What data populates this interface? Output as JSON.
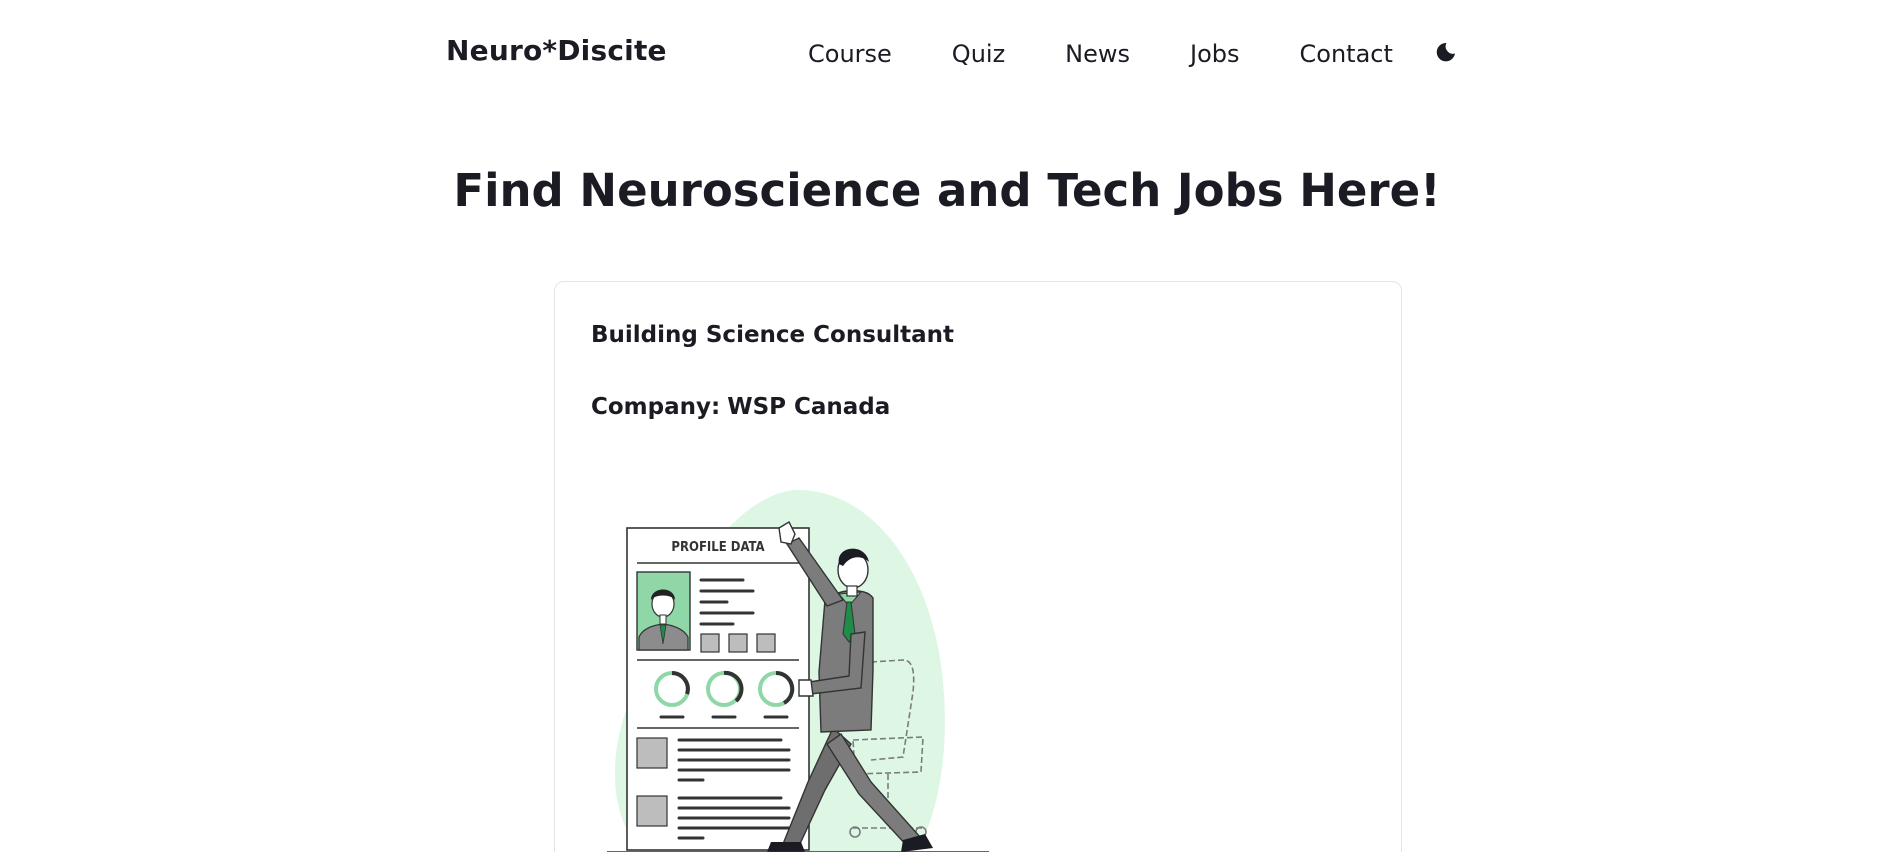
{
  "navbar": {
    "brand": "Neuro*Discite",
    "links": [
      {
        "label": "Course"
      },
      {
        "label": "Quiz"
      },
      {
        "label": "News"
      },
      {
        "label": "Jobs"
      },
      {
        "label": "Contact"
      }
    ],
    "theme_icon": "moon-icon"
  },
  "page": {
    "title": "Find Neuroscience and Tech Jobs Here!"
  },
  "job": {
    "title": "Building Science Consultant",
    "company_label": "Company:",
    "company_name": "WSP Canada",
    "illustration": {
      "heading": "PROFILE DATA",
      "icon": "resume-illustration"
    }
  },
  "colors": {
    "text": "#1b1b24",
    "accent_green": "#8fd7a7",
    "light_green": "#def7e4",
    "card_border": "#e4e4e4",
    "suit_gray": "#7c7c7c"
  }
}
